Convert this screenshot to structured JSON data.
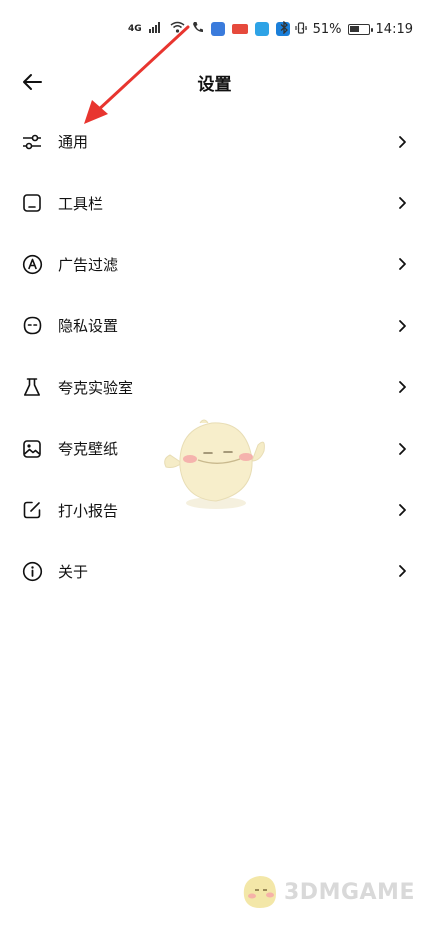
{
  "status_bar": {
    "network": "4G",
    "battery_percent": "51%",
    "time": "14:19",
    "icons": [
      "signal-icon",
      "wifi-icon",
      "phone-icon",
      "app-notification-icon",
      "bluetooth-icon",
      "vibrate-icon",
      "battery-icon"
    ],
    "battery_level": 0.51
  },
  "header": {
    "title": "设置",
    "back_icon": "arrow-left-icon"
  },
  "menu": {
    "items": [
      {
        "label": "通用",
        "icon": "sliders-icon"
      },
      {
        "label": "工具栏",
        "icon": "toolbar-icon"
      },
      {
        "label": "广告过滤",
        "icon": "ad-block-icon"
      },
      {
        "label": "隐私设置",
        "icon": "privacy-icon"
      },
      {
        "label": "夸克实验室",
        "icon": "flask-icon"
      },
      {
        "label": "夸克壁纸",
        "icon": "wallpaper-icon"
      },
      {
        "label": "打小报告",
        "icon": "feedback-icon"
      },
      {
        "label": "关于",
        "icon": "info-icon"
      }
    ],
    "chevron_icon": "chevron-right-icon"
  },
  "watermark": {
    "text": "3DMGAME"
  },
  "colors": {
    "annotation": "#e8352f",
    "text": "#111111",
    "mascot_body": "#f5ecc7",
    "mascot_cheek": "#f4a8a8",
    "watermark": "#d9d9d9"
  }
}
